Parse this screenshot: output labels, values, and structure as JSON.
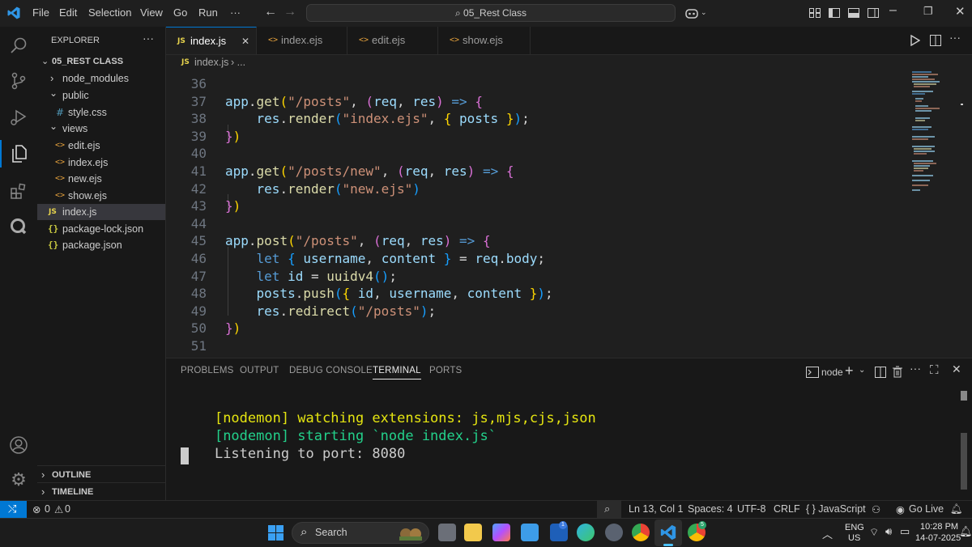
{
  "titlebar": {
    "menus": [
      "File",
      "Edit",
      "Selection",
      "View",
      "Go",
      "Run",
      "···"
    ],
    "search_text": "05_Rest Class"
  },
  "explorer": {
    "header": "EXPLORER",
    "root": "05_REST CLASS",
    "items": [
      {
        "label": "node_modules",
        "kind": "folder"
      },
      {
        "label": "public",
        "kind": "folder-open"
      },
      {
        "label": "style.css",
        "kind": "css"
      },
      {
        "label": "views",
        "kind": "folder-open"
      },
      {
        "label": "edit.ejs",
        "kind": "ejs"
      },
      {
        "label": "index.ejs",
        "kind": "ejs"
      },
      {
        "label": "new.ejs",
        "kind": "ejs"
      },
      {
        "label": "show.ejs",
        "kind": "ejs"
      },
      {
        "label": "index.js",
        "kind": "js"
      },
      {
        "label": "package-lock.json",
        "kind": "json"
      },
      {
        "label": "package.json",
        "kind": "json"
      }
    ],
    "outline": "OUTLINE",
    "timeline": "TIMELINE",
    "icons": {
      "folder_closed": "›",
      "folder_open": "⌄",
      "ejs": "<>",
      "js": "JS",
      "css": "#",
      "json": "{}"
    }
  },
  "tabs": [
    {
      "label": "index.js",
      "active": true,
      "icon": "JS"
    },
    {
      "label": "index.ejs",
      "active": false,
      "icon": "<>"
    },
    {
      "label": "edit.ejs",
      "active": false,
      "icon": "<>"
    },
    {
      "label": "show.ejs",
      "active": false,
      "icon": "<>"
    }
  ],
  "breadcrumb": {
    "icon": "JS",
    "file": "index.js",
    "rest": "› ..."
  },
  "editor": {
    "lines": [
      {
        "n": "36",
        "tokens": []
      },
      {
        "n": "37",
        "tokens": [
          [
            "k-id",
            "app"
          ],
          [
            "k-pu",
            "."
          ],
          [
            "k-fn",
            "get"
          ],
          [
            "k-p1",
            "("
          ],
          [
            "k-str",
            "\"/posts\""
          ],
          [
            "k-pu",
            ", "
          ],
          [
            "k-p2",
            "("
          ],
          [
            "k-id",
            "req"
          ],
          [
            "k-pu",
            ", "
          ],
          [
            "k-id",
            "res"
          ],
          [
            "k-p2",
            ")"
          ],
          [
            "k-pu",
            " "
          ],
          [
            "k-kw",
            "=>"
          ],
          [
            "k-pu",
            " "
          ],
          [
            "k-p2",
            "{"
          ]
        ]
      },
      {
        "n": "38",
        "tokens": [
          [
            "k-pu",
            "    "
          ],
          [
            "k-id",
            "res"
          ],
          [
            "k-pu",
            "."
          ],
          [
            "k-fn",
            "render"
          ],
          [
            "k-br",
            "("
          ],
          [
            "k-str",
            "\"index.ejs\""
          ],
          [
            "k-pu",
            ", "
          ],
          [
            "k-p1",
            "{ "
          ],
          [
            "k-id",
            "posts"
          ],
          [
            "k-p1",
            " }"
          ],
          [
            "k-br",
            ")"
          ],
          [
            "k-pu",
            ";"
          ]
        ]
      },
      {
        "n": "39",
        "tokens": [
          [
            "k-p2",
            "}"
          ],
          [
            "k-p1",
            ")"
          ]
        ]
      },
      {
        "n": "40",
        "tokens": []
      },
      {
        "n": "41",
        "tokens": [
          [
            "k-id",
            "app"
          ],
          [
            "k-pu",
            "."
          ],
          [
            "k-fn",
            "get"
          ],
          [
            "k-p1",
            "("
          ],
          [
            "k-str",
            "\"/posts/new\""
          ],
          [
            "k-pu",
            ", "
          ],
          [
            "k-p2",
            "("
          ],
          [
            "k-id",
            "req"
          ],
          [
            "k-pu",
            ", "
          ],
          [
            "k-id",
            "res"
          ],
          [
            "k-p2",
            ")"
          ],
          [
            "k-pu",
            " "
          ],
          [
            "k-kw",
            "=>"
          ],
          [
            "k-pu",
            " "
          ],
          [
            "k-p2",
            "{"
          ]
        ]
      },
      {
        "n": "42",
        "tokens": [
          [
            "k-pu",
            "    "
          ],
          [
            "k-id",
            "res"
          ],
          [
            "k-pu",
            "."
          ],
          [
            "k-fn",
            "render"
          ],
          [
            "k-br",
            "("
          ],
          [
            "k-str",
            "\"new.ejs\""
          ],
          [
            "k-br",
            ")"
          ]
        ]
      },
      {
        "n": "43",
        "tokens": [
          [
            "k-p2",
            "}"
          ],
          [
            "k-p1",
            ")"
          ]
        ]
      },
      {
        "n": "44",
        "tokens": []
      },
      {
        "n": "45",
        "tokens": [
          [
            "k-id",
            "app"
          ],
          [
            "k-pu",
            "."
          ],
          [
            "k-fn",
            "post"
          ],
          [
            "k-p1",
            "("
          ],
          [
            "k-str",
            "\"/posts\""
          ],
          [
            "k-pu",
            ", "
          ],
          [
            "k-p2",
            "("
          ],
          [
            "k-id",
            "req"
          ],
          [
            "k-pu",
            ", "
          ],
          [
            "k-id",
            "res"
          ],
          [
            "k-p2",
            ")"
          ],
          [
            "k-pu",
            " "
          ],
          [
            "k-kw",
            "=>"
          ],
          [
            "k-pu",
            " "
          ],
          [
            "k-p2",
            "{"
          ]
        ]
      },
      {
        "n": "46",
        "tokens": [
          [
            "k-pu",
            "    "
          ],
          [
            "k-kw",
            "let"
          ],
          [
            "k-pu",
            " "
          ],
          [
            "k-br",
            "{"
          ],
          [
            "k-pu",
            " "
          ],
          [
            "k-id",
            "username"
          ],
          [
            "k-pu",
            ", "
          ],
          [
            "k-id",
            "content"
          ],
          [
            "k-pu",
            " "
          ],
          [
            "k-br",
            "}"
          ],
          [
            "k-pu",
            " = "
          ],
          [
            "k-id",
            "req"
          ],
          [
            "k-pu",
            "."
          ],
          [
            "k-id",
            "body"
          ],
          [
            "k-pu",
            ";"
          ]
        ]
      },
      {
        "n": "47",
        "tokens": [
          [
            "k-pu",
            "    "
          ],
          [
            "k-kw",
            "let"
          ],
          [
            "k-pu",
            " "
          ],
          [
            "k-id",
            "id"
          ],
          [
            "k-pu",
            " = "
          ],
          [
            "k-fn",
            "uuidv4"
          ],
          [
            "k-br",
            "()"
          ],
          [
            "k-pu",
            ";"
          ]
        ]
      },
      {
        "n": "48",
        "tokens": [
          [
            "k-pu",
            "    "
          ],
          [
            "k-id",
            "posts"
          ],
          [
            "k-pu",
            "."
          ],
          [
            "k-fn",
            "push"
          ],
          [
            "k-br",
            "("
          ],
          [
            "k-p1",
            "{"
          ],
          [
            "k-pu",
            " "
          ],
          [
            "k-id",
            "id"
          ],
          [
            "k-pu",
            ", "
          ],
          [
            "k-id",
            "username"
          ],
          [
            "k-pu",
            ", "
          ],
          [
            "k-id",
            "content"
          ],
          [
            "k-pu",
            " "
          ],
          [
            "k-p1",
            "}"
          ],
          [
            "k-br",
            ")"
          ],
          [
            "k-pu",
            ";"
          ]
        ]
      },
      {
        "n": "49",
        "tokens": [
          [
            "k-pu",
            "    "
          ],
          [
            "k-id",
            "res"
          ],
          [
            "k-pu",
            "."
          ],
          [
            "k-fn",
            "redirect"
          ],
          [
            "k-br",
            "("
          ],
          [
            "k-str",
            "\"/posts\""
          ],
          [
            "k-br",
            ")"
          ],
          [
            "k-pu",
            ";"
          ]
        ]
      },
      {
        "n": "50",
        "tokens": [
          [
            "k-p2",
            "}"
          ],
          [
            "k-p1",
            ")"
          ]
        ]
      },
      {
        "n": "51",
        "tokens": []
      }
    ]
  },
  "panel": {
    "tabs": [
      "PROBLEMS",
      "OUTPUT",
      "DEBUG CONSOLE",
      "TERMINAL",
      "PORTS"
    ],
    "active_tab": "TERMINAL",
    "terminal_name": "node",
    "terminal_lines": [
      {
        "text": "[nodemon] watching extensions: js,mjs,cjs,json",
        "color": "#e5e510"
      },
      {
        "text": "[nodemon] starting `node index.js`",
        "color": "#23d18b"
      },
      {
        "text": "Listening to port: 8080",
        "color": "#cccccc"
      }
    ]
  },
  "statusbar": {
    "errors": "0",
    "warnings": "0",
    "position": "Ln 13, Col 1",
    "spaces": "Spaces: 4",
    "encoding": "UTF-8",
    "eol": "CRLF",
    "language": "{ } JavaScript",
    "golive": "Go Live"
  },
  "taskbar": {
    "search": "Search",
    "lang1": "ENG",
    "lang2": "US",
    "time": "10:28 PM",
    "date": "14-07-2025"
  }
}
